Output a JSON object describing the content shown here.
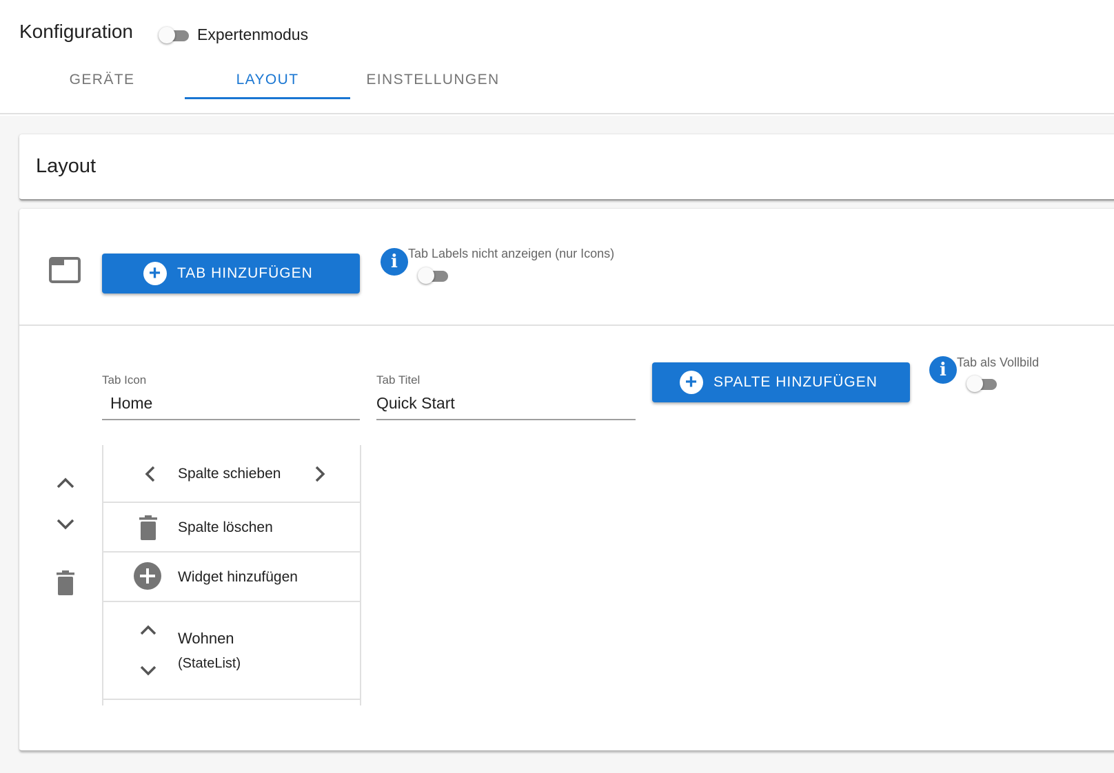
{
  "page": {
    "title": "Konfiguration",
    "expert_mode_label": "Expertenmodus"
  },
  "tabs": [
    {
      "label": "GERÄTE",
      "active": false
    },
    {
      "label": "LAYOUT",
      "active": true
    },
    {
      "label": "EINSTELLUNGEN",
      "active": false
    }
  ],
  "layout_header": {
    "title": "Layout"
  },
  "tab_section": {
    "add_tab_button": "TAB HINZUFÜGEN",
    "hide_labels_label": "Tab Labels nicht anzeigen (nur Icons)"
  },
  "tab_editor": {
    "icon_label": "Tab Icon",
    "icon_value": "Home",
    "title_label": "Tab Titel",
    "title_value": "Quick Start",
    "add_column_button": "SPALTE HINZUFÜGEN",
    "fullscreen_label": "Tab als Vollbild"
  },
  "column": {
    "move_label": "Spalte schieben",
    "delete_label": "Spalte löschen",
    "add_widget_label": "Widget hinzufügen",
    "widget_name": "Wohnen",
    "widget_type": "(StateList)"
  },
  "colors": {
    "accent": "#1976d2",
    "icon_grey": "#757575",
    "toggle_off_track": "#8a8a8a"
  },
  "icons": [
    "tab-folder-icon",
    "plus-circle-icon",
    "info-icon",
    "chevron-up-icon",
    "chevron-down-icon",
    "chevron-left-icon",
    "chevron-right-icon",
    "trash-icon"
  ]
}
